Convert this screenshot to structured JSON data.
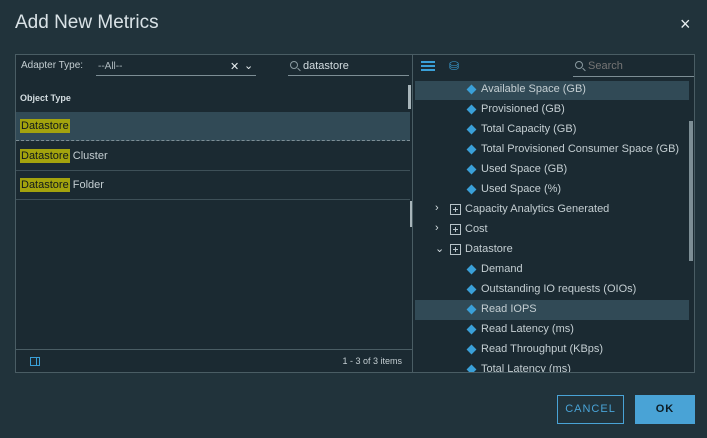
{
  "dialog": {
    "title": "Add New Metrics",
    "close_icon": "×"
  },
  "left": {
    "adapter_label": "Adapter Type:",
    "adapter_value": "--All--",
    "search_value": "datastore",
    "column_header": "Object Type",
    "rows": [
      {
        "match": "Datastore",
        "rest": "",
        "selected": true
      },
      {
        "match": "Datastore",
        "rest": " Cluster",
        "selected": false
      },
      {
        "match": "Datastore",
        "rest": " Folder",
        "selected": false
      }
    ],
    "pager": "1 - 3 of 3 items"
  },
  "right": {
    "search_placeholder": "Search",
    "tree": [
      {
        "kind": "metric",
        "label": "Available Space (GB)",
        "selected": true
      },
      {
        "kind": "metric",
        "label": "Provisioned (GB)"
      },
      {
        "kind": "metric",
        "label": "Total Capacity (GB)"
      },
      {
        "kind": "metric",
        "label": "Total Provisioned Consumer Space (GB)"
      },
      {
        "kind": "metric",
        "label": "Used Space (GB)"
      },
      {
        "kind": "metric",
        "label": "Used Space (%)"
      },
      {
        "kind": "group",
        "label": "Capacity Analytics Generated",
        "expanded": false
      },
      {
        "kind": "group",
        "label": "Cost",
        "expanded": false
      },
      {
        "kind": "group",
        "label": "Datastore",
        "expanded": true
      },
      {
        "kind": "metric",
        "label": "Demand"
      },
      {
        "kind": "metric",
        "label": "Outstanding IO requests (OIOs)"
      },
      {
        "kind": "metric",
        "label": "Read IOPS",
        "selected": true
      },
      {
        "kind": "metric",
        "label": "Read Latency (ms)"
      },
      {
        "kind": "metric",
        "label": "Read Throughput (KBps)"
      },
      {
        "kind": "metric",
        "label": "Total Latency (ms)"
      }
    ]
  },
  "buttons": {
    "cancel": "CANCEL",
    "ok": "OK"
  }
}
